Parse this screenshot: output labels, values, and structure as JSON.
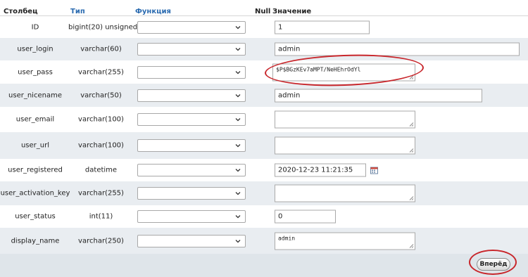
{
  "header": {
    "column": "Столбец",
    "type": "Тип",
    "function": "Функция",
    "null": "Null",
    "value": "Значение"
  },
  "rows": [
    {
      "name": "ID",
      "type": "bigint(20) unsigned",
      "value": "1"
    },
    {
      "name": "user_login",
      "type": "varchar(60)",
      "value": "admin"
    },
    {
      "name": "user_pass",
      "type": "varchar(255)",
      "value": "$P$BGzKEv7aMPT/NeHEhrOdYl"
    },
    {
      "name": "user_nicename",
      "type": "varchar(50)",
      "value": "admin"
    },
    {
      "name": "user_email",
      "type": "varchar(100)",
      "value": ""
    },
    {
      "name": "user_url",
      "type": "varchar(100)",
      "value": ""
    },
    {
      "name": "user_registered",
      "type": "datetime",
      "value": "2020-12-23 11:21:35"
    },
    {
      "name": "user_activation_key",
      "type": "varchar(255)",
      "value": ""
    },
    {
      "name": "user_status",
      "type": "int(11)",
      "value": "0"
    },
    {
      "name": "display_name",
      "type": "varchar(250)",
      "value": "admin"
    }
  ],
  "footer": {
    "submit_label": "Вперёд"
  },
  "colors": {
    "link": "#2b6bb0",
    "annotation": "#c8262b",
    "row_alt": "#e9edf1"
  },
  "icons": [
    "chevron-down-icon",
    "calendar-icon",
    "resize-grip-icon"
  ]
}
